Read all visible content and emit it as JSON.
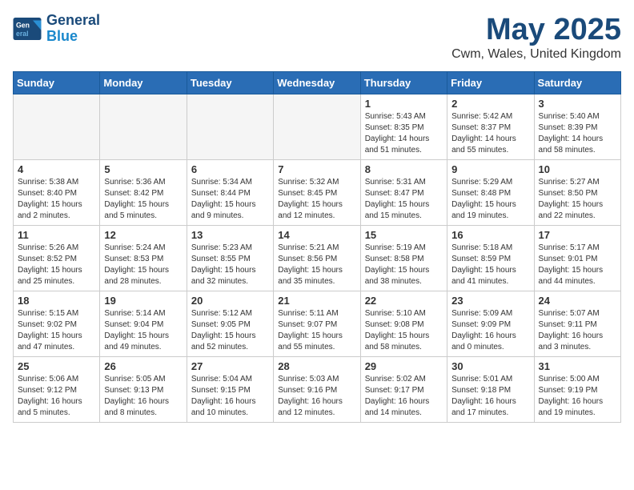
{
  "header": {
    "logo_line1": "General",
    "logo_line2": "Blue",
    "title": "May 2025",
    "location": "Cwm, Wales, United Kingdom"
  },
  "weekdays": [
    "Sunday",
    "Monday",
    "Tuesday",
    "Wednesday",
    "Thursday",
    "Friday",
    "Saturday"
  ],
  "weeks": [
    [
      {
        "day": "",
        "info": ""
      },
      {
        "day": "",
        "info": ""
      },
      {
        "day": "",
        "info": ""
      },
      {
        "day": "",
        "info": ""
      },
      {
        "day": "1",
        "info": "Sunrise: 5:43 AM\nSunset: 8:35 PM\nDaylight: 14 hours\nand 51 minutes."
      },
      {
        "day": "2",
        "info": "Sunrise: 5:42 AM\nSunset: 8:37 PM\nDaylight: 14 hours\nand 55 minutes."
      },
      {
        "day": "3",
        "info": "Sunrise: 5:40 AM\nSunset: 8:39 PM\nDaylight: 14 hours\nand 58 minutes."
      }
    ],
    [
      {
        "day": "4",
        "info": "Sunrise: 5:38 AM\nSunset: 8:40 PM\nDaylight: 15 hours\nand 2 minutes."
      },
      {
        "day": "5",
        "info": "Sunrise: 5:36 AM\nSunset: 8:42 PM\nDaylight: 15 hours\nand 5 minutes."
      },
      {
        "day": "6",
        "info": "Sunrise: 5:34 AM\nSunset: 8:44 PM\nDaylight: 15 hours\nand 9 minutes."
      },
      {
        "day": "7",
        "info": "Sunrise: 5:32 AM\nSunset: 8:45 PM\nDaylight: 15 hours\nand 12 minutes."
      },
      {
        "day": "8",
        "info": "Sunrise: 5:31 AM\nSunset: 8:47 PM\nDaylight: 15 hours\nand 15 minutes."
      },
      {
        "day": "9",
        "info": "Sunrise: 5:29 AM\nSunset: 8:48 PM\nDaylight: 15 hours\nand 19 minutes."
      },
      {
        "day": "10",
        "info": "Sunrise: 5:27 AM\nSunset: 8:50 PM\nDaylight: 15 hours\nand 22 minutes."
      }
    ],
    [
      {
        "day": "11",
        "info": "Sunrise: 5:26 AM\nSunset: 8:52 PM\nDaylight: 15 hours\nand 25 minutes."
      },
      {
        "day": "12",
        "info": "Sunrise: 5:24 AM\nSunset: 8:53 PM\nDaylight: 15 hours\nand 28 minutes."
      },
      {
        "day": "13",
        "info": "Sunrise: 5:23 AM\nSunset: 8:55 PM\nDaylight: 15 hours\nand 32 minutes."
      },
      {
        "day": "14",
        "info": "Sunrise: 5:21 AM\nSunset: 8:56 PM\nDaylight: 15 hours\nand 35 minutes."
      },
      {
        "day": "15",
        "info": "Sunrise: 5:19 AM\nSunset: 8:58 PM\nDaylight: 15 hours\nand 38 minutes."
      },
      {
        "day": "16",
        "info": "Sunrise: 5:18 AM\nSunset: 8:59 PM\nDaylight: 15 hours\nand 41 minutes."
      },
      {
        "day": "17",
        "info": "Sunrise: 5:17 AM\nSunset: 9:01 PM\nDaylight: 15 hours\nand 44 minutes."
      }
    ],
    [
      {
        "day": "18",
        "info": "Sunrise: 5:15 AM\nSunset: 9:02 PM\nDaylight: 15 hours\nand 47 minutes."
      },
      {
        "day": "19",
        "info": "Sunrise: 5:14 AM\nSunset: 9:04 PM\nDaylight: 15 hours\nand 49 minutes."
      },
      {
        "day": "20",
        "info": "Sunrise: 5:12 AM\nSunset: 9:05 PM\nDaylight: 15 hours\nand 52 minutes."
      },
      {
        "day": "21",
        "info": "Sunrise: 5:11 AM\nSunset: 9:07 PM\nDaylight: 15 hours\nand 55 minutes."
      },
      {
        "day": "22",
        "info": "Sunrise: 5:10 AM\nSunset: 9:08 PM\nDaylight: 15 hours\nand 58 minutes."
      },
      {
        "day": "23",
        "info": "Sunrise: 5:09 AM\nSunset: 9:09 PM\nDaylight: 16 hours\nand 0 minutes."
      },
      {
        "day": "24",
        "info": "Sunrise: 5:07 AM\nSunset: 9:11 PM\nDaylight: 16 hours\nand 3 minutes."
      }
    ],
    [
      {
        "day": "25",
        "info": "Sunrise: 5:06 AM\nSunset: 9:12 PM\nDaylight: 16 hours\nand 5 minutes."
      },
      {
        "day": "26",
        "info": "Sunrise: 5:05 AM\nSunset: 9:13 PM\nDaylight: 16 hours\nand 8 minutes."
      },
      {
        "day": "27",
        "info": "Sunrise: 5:04 AM\nSunset: 9:15 PM\nDaylight: 16 hours\nand 10 minutes."
      },
      {
        "day": "28",
        "info": "Sunrise: 5:03 AM\nSunset: 9:16 PM\nDaylight: 16 hours\nand 12 minutes."
      },
      {
        "day": "29",
        "info": "Sunrise: 5:02 AM\nSunset: 9:17 PM\nDaylight: 16 hours\nand 14 minutes."
      },
      {
        "day": "30",
        "info": "Sunrise: 5:01 AM\nSunset: 9:18 PM\nDaylight: 16 hours\nand 17 minutes."
      },
      {
        "day": "31",
        "info": "Sunrise: 5:00 AM\nSunset: 9:19 PM\nDaylight: 16 hours\nand 19 minutes."
      }
    ]
  ]
}
